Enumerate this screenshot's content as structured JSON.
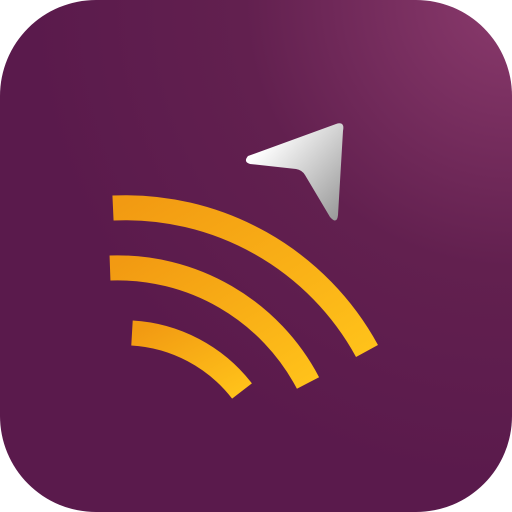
{
  "icon": {
    "name": "broadcast-navigation-app-icon",
    "colors": {
      "background_base": "#5a1a4c",
      "background_highlight": "#8a3a6c",
      "waves_light": "#ffc21a",
      "waves_dark": "#f29a12",
      "arrow_light": "#ffffff",
      "arrow_dark": "#9a9a9a"
    }
  }
}
